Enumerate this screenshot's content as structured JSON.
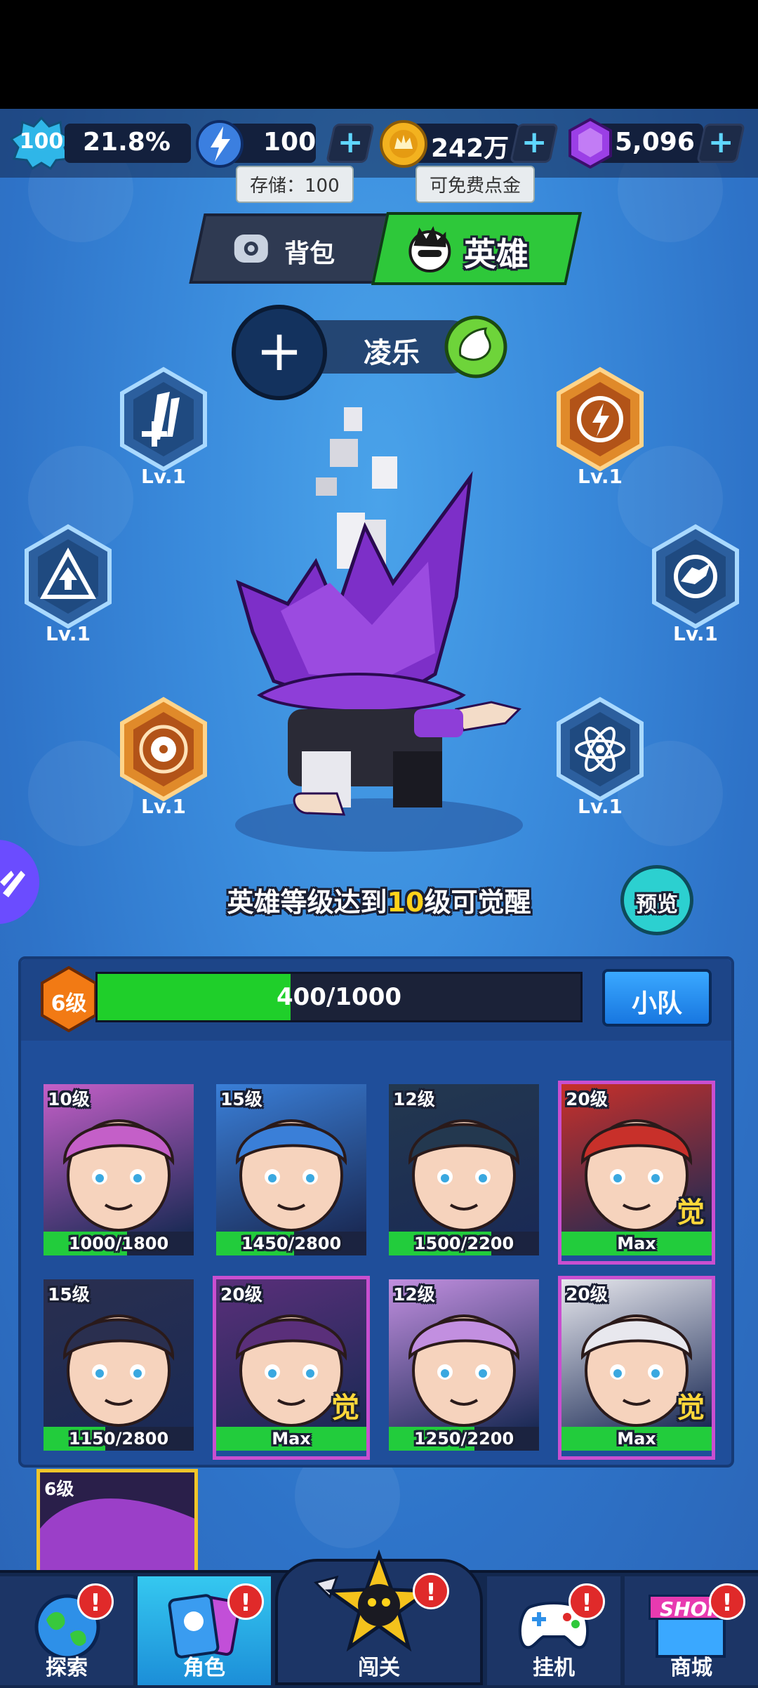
{
  "player": {
    "level": "100",
    "exp_percent": "21.8%"
  },
  "resources": {
    "energy": {
      "value": "100",
      "tooltip": "存储：100"
    },
    "gold": {
      "value": "242万",
      "tooltip": "可免费点金"
    },
    "gems": {
      "value": "5,096"
    }
  },
  "tabs": [
    {
      "label": "背包",
      "active": false
    },
    {
      "label": "英雄",
      "active": true
    }
  ],
  "hero": {
    "name": "凌乐"
  },
  "skills": [
    {
      "icon": "slash-heal-icon",
      "level": "Lv.1"
    },
    {
      "icon": "lightning-burst-icon",
      "level": "Lv.1"
    },
    {
      "icon": "triangle-arrow-icon",
      "level": "Lv.1"
    },
    {
      "icon": "wolf-compass-icon",
      "level": "Lv.1"
    },
    {
      "icon": "ball-vortex-icon",
      "level": "Lv.1"
    },
    {
      "icon": "atom-icon",
      "level": "Lv.1"
    }
  ],
  "awaken_hint": {
    "before": "英雄等级达到",
    "highlight": "10",
    "after": "级可觉醒"
  },
  "preview_label": "预览",
  "team": {
    "level_badge": "6级",
    "progress_text": "400/1000",
    "progress": 0.4,
    "squad_label": "小队"
  },
  "heroes": [
    {
      "level": "10级",
      "progress_text": "1000/1800",
      "progress": 0.556,
      "awakened": false,
      "theme": "#c45fc8"
    },
    {
      "level": "15级",
      "progress_text": "1450/2800",
      "progress": 0.518,
      "awakened": false,
      "theme": "#3a7fd8"
    },
    {
      "level": "12级",
      "progress_text": "1500/2200",
      "progress": 0.682,
      "awakened": false,
      "theme": "#23384f"
    },
    {
      "level": "20级",
      "progress_text": "Max",
      "progress": 1.0,
      "awakened": true,
      "awaken_mark": "觉",
      "theme": "#c8302a"
    },
    {
      "level": "15级",
      "progress_text": "1150/2800",
      "progress": 0.411,
      "awakened": false,
      "theme": "#2a2f4f"
    },
    {
      "level": "20级",
      "progress_text": "Max",
      "progress": 1.0,
      "awakened": true,
      "awaken_mark": "觉",
      "theme": "#5a2f7a"
    },
    {
      "level": "12级",
      "progress_text": "1250/2200",
      "progress": 0.568,
      "awakened": false,
      "theme": "#c28fe0"
    },
    {
      "level": "20级",
      "progress_text": "Max",
      "progress": 1.0,
      "awakened": true,
      "awaken_mark": "觉",
      "theme": "#e8e8ee"
    }
  ],
  "partial_hero": {
    "level": "6级"
  },
  "nav": [
    {
      "label": "探索",
      "badge": "!",
      "active": false
    },
    {
      "label": "角色",
      "badge": "!",
      "active": true
    },
    {
      "label": "闯关",
      "badge": "!",
      "active": false
    },
    {
      "label": "挂机",
      "badge": "!",
      "active": false
    },
    {
      "label": "商城",
      "badge": "!",
      "shop_text": "SHOP",
      "active": false
    }
  ]
}
